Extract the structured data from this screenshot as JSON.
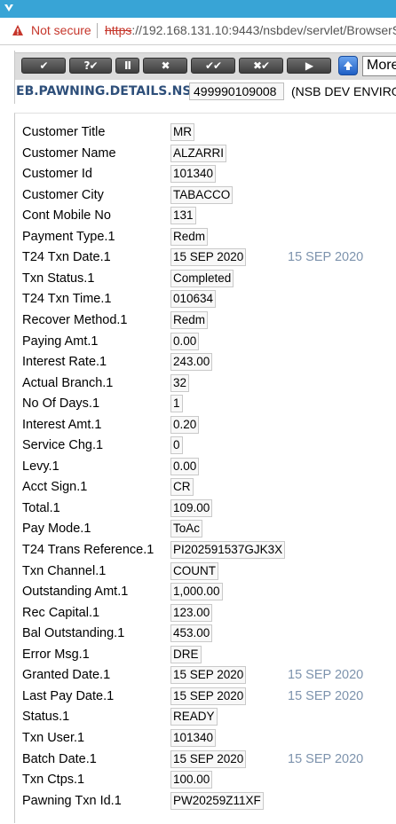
{
  "browser": {
    "not_secure_label": "Not secure",
    "url_scheme": "https",
    "url_rest": "://192.168.131.10:9443/nsbdev/servlet/BrowserS"
  },
  "toolbar": {
    "buttons": [
      {
        "glyph": "✔"
      },
      {
        "glyph": "?✔"
      },
      {
        "glyph": "II"
      },
      {
        "glyph": "✖"
      },
      {
        "glyph": "✔✔"
      },
      {
        "glyph": "✖✔"
      },
      {
        "glyph": "▶"
      }
    ],
    "more_select": "More"
  },
  "header": {
    "application": "EB.PAWNING.DETAILS.NSB",
    "record_id": "499990109008",
    "environment": "(NSB DEV ENVIRO"
  },
  "fields": [
    {
      "label": "Customer Title",
      "value": "MR"
    },
    {
      "label": "Customer Name",
      "value": "ALZARRI"
    },
    {
      "label": "Customer Id",
      "value": "101340"
    },
    {
      "label": "Customer City",
      "value": "TABACCO"
    },
    {
      "label": "Cont Mobile No",
      "value": "131"
    },
    {
      "label": "Payment Type.1",
      "value": "Redm"
    },
    {
      "label": "T24 Txn Date.1",
      "value": "15 SEP 2020",
      "extra": "15 SEP 2020"
    },
    {
      "label": "Txn Status.1",
      "value": "Completed"
    },
    {
      "label": "T24 Txn Time.1",
      "value": "010634"
    },
    {
      "label": "Recover Method.1",
      "value": "Redm"
    },
    {
      "label": "Paying Amt.1",
      "value": "0.00"
    },
    {
      "label": "Interest Rate.1",
      "value": "243.00"
    },
    {
      "label": "Actual Branch.1",
      "value": "32"
    },
    {
      "label": "No Of Days.1",
      "value": "1"
    },
    {
      "label": "Interest Amt.1",
      "value": "0.20"
    },
    {
      "label": "Service Chg.1",
      "value": "0"
    },
    {
      "label": "Levy.1",
      "value": "0.00"
    },
    {
      "label": "Acct Sign.1",
      "value": "CR"
    },
    {
      "label": "Total.1",
      "value": "109.00"
    },
    {
      "label": "Pay Mode.1",
      "value": "ToAc"
    },
    {
      "label": "T24 Trans Reference.1",
      "value": "PI202591537GJK3X"
    },
    {
      "label": "Txn Channel.1",
      "value": "COUNT"
    },
    {
      "label": "Outstanding Amt.1",
      "value": "1,000.00"
    },
    {
      "label": "Rec Capital.1",
      "value": "123.00"
    },
    {
      "label": "Bal Outstanding.1",
      "value": "453.00"
    },
    {
      "label": "Error Msg.1",
      "value": "DRE"
    },
    {
      "label": "Granted Date.1",
      "value": "15 SEP 2020",
      "extra": "15 SEP 2020"
    },
    {
      "label": "Last Pay Date.1",
      "value": "15 SEP 2020",
      "extra": "15 SEP 2020"
    },
    {
      "label": "Status.1",
      "value": "READY"
    },
    {
      "label": "Txn User.1",
      "value": "101340"
    },
    {
      "label": "Batch Date.1",
      "value": "15 SEP 2020",
      "extra": "15 SEP 2020"
    },
    {
      "label": "Txn Ctps.1",
      "value": "100.00"
    },
    {
      "label": "Pawning Txn Id.1",
      "value": "PW20259Z11XF"
    }
  ]
}
